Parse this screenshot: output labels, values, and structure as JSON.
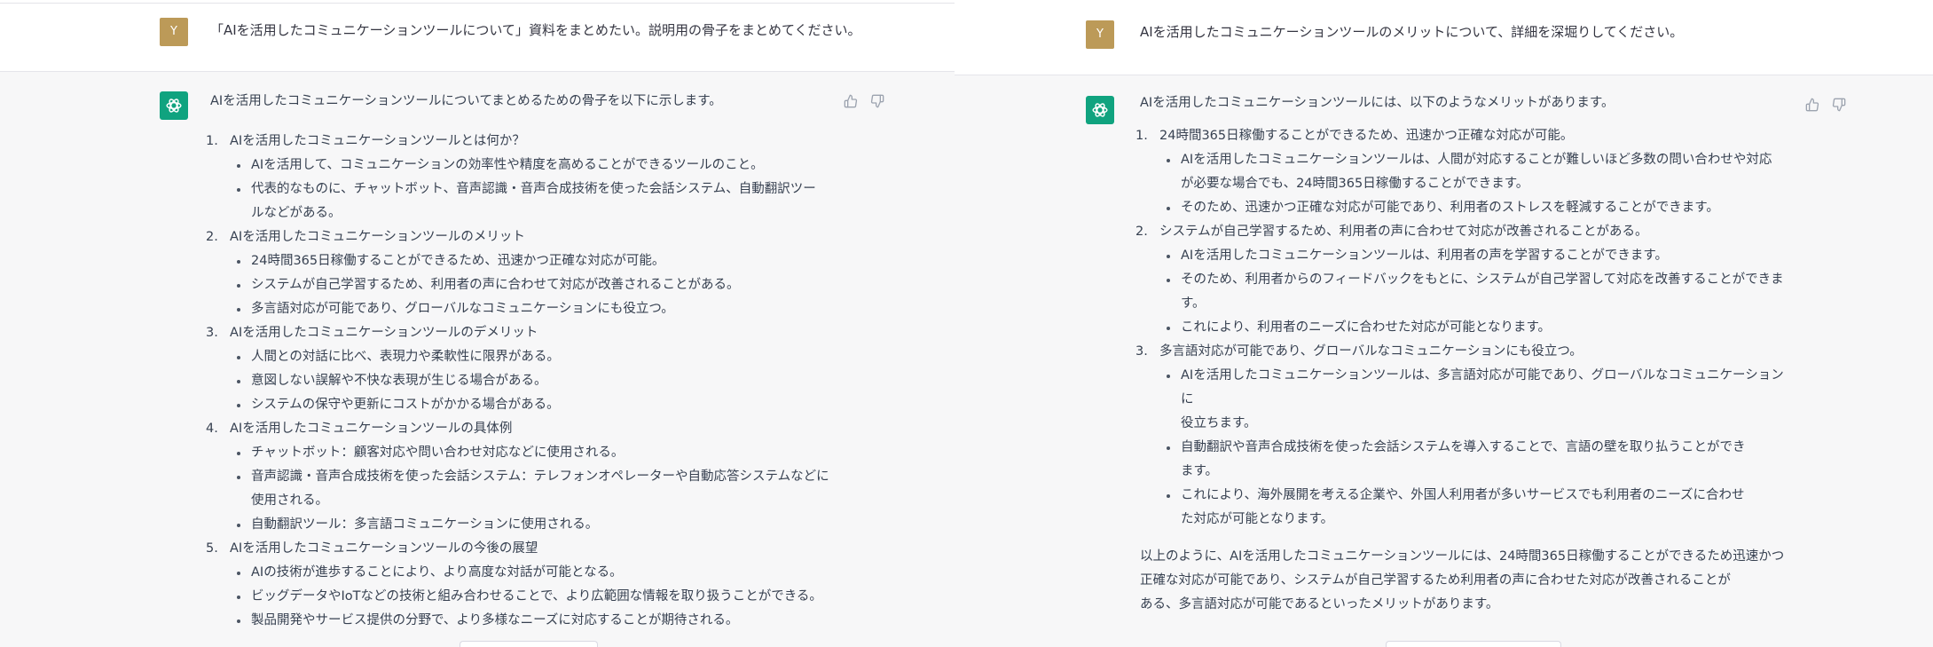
{
  "left": {
    "user": {
      "avatar_letter": "Y",
      "message": "「AIを活用したコミュニケーションツールについて」資料をまとめたい。説明用の骨子をまとめてください。"
    },
    "assistant": {
      "intro": "AIを活用したコミュニケーションツールについてまとめるための骨子を以下に示します。",
      "sections": [
        {
          "number": "1.",
          "title": "AIを活用したコミュニケーションツールとは何か？",
          "bullets": [
            "AIを活用して、コミュニケーションの効率性や精度を高めることができるツールのこと。",
            "代表的なものに、チャットボット、音声認識・音声合成技術を使った会話システム、自動翻訳ツー|ルなどがある。"
          ]
        },
        {
          "number": "2.",
          "title": "AIを活用したコミュニケーションツールのメリット",
          "bullets": [
            "24時間365日稼働することができるため、迅速かつ正確な対応が可能。",
            "システムが自己学習するため、利用者の声に合わせて対応が改善されることがある。",
            "多言語対応が可能であり、グローバルなコミュニケーションにも役立つ。"
          ]
        },
        {
          "number": "3.",
          "title": "AIを活用したコミュニケーションツールのデメリット",
          "bullets": [
            "人間との対話に比べ、表現力や柔軟性に限界がある。",
            "意図しない誤解や不快な表現が生じる場合がある。",
            "システムの保守や更新にコストがかかる場合がある。"
          ]
        },
        {
          "number": "4.",
          "title": "AIを活用したコミュニケーションツールの具体例",
          "bullets": [
            "チャットボット：顧客対応や問い合わせ対応などに使用される。",
            "音声認識・音声合成技術を使った会話システム：テレフォンオペレーターや自動応答システムなどに|使用される。",
            "自動翻訳ツール：多言語コミュニケーションに使用される。"
          ]
        },
        {
          "number": "5.",
          "title": "AIを活用したコミュニケーションツールの今後の展望",
          "bullets": [
            "AIの技術が進歩することにより、より高度な対話が可能となる。",
            "ビッグデータやIoTなどの技術と組み合わせることで、より広範囲な情報を取り扱うことができる。",
            "製品開発やサービス提供の分野で、より多様なニーズに対応することが期待される。"
          ]
        }
      ]
    }
  },
  "right": {
    "user": {
      "avatar_letter": "Y",
      "message": "AIを活用したコミュニケーションツールのメリットについて、詳細を深堀りしてください。"
    },
    "assistant": {
      "intro": "AIを活用したコミュニケーションツールには、以下のようなメリットがあります。",
      "sections": [
        {
          "number": "1.",
          "title": "24時間365日稼働することができるため、迅速かつ正確な対応が可能。",
          "bullets": [
            "AIを活用したコミュニケーションツールは、人間が対応することが難しいほど多数の問い合わせや対応|が必要な場合でも、24時間365日稼働することができます。",
            "そのため、迅速かつ正確な対応が可能であり、利用者のストレスを軽減することができます。"
          ]
        },
        {
          "number": "2.",
          "title": "システムが自己学習するため、利用者の声に合わせて対応が改善されることがある。",
          "bullets": [
            "AIを活用したコミュニケーションツールは、利用者の声を学習することができます。",
            "そのため、利用者からのフィードバックをもとに、システムが自己学習して対応を改善することができま|す。",
            "これにより、利用者のニーズに合わせた対応が可能となります。"
          ]
        },
        {
          "number": "3.",
          "title": "多言語対応が可能であり、グローバルなコミュニケーションにも役立つ。",
          "bullets": [
            "AIを活用したコミュニケーションツールは、多言語対応が可能であり、グローバルなコミュニケーションに|役立ちます。",
            "自動翻訳や音声合成技術を使った会話システムを導入することで、言語の壁を取り払うことができ|ます。",
            "これにより、海外展開を考える企業や、外国人利用者が多いサービスでも利用者のニーズに合わせ|た対応が可能となります。"
          ]
        }
      ],
      "conclusion": "以上のように、AIを活用したコミュニケーションツールには、24時間365日稼働することができるため迅速かつ|正確な対応が可能であり、システムが自己学習するため利用者の声に合わせた対応が改善されることが|ある、多言語対応が可能であるといったメリットがあります。"
    }
  },
  "icons": {
    "bot_avatar": "openai-logo-icon",
    "thumbs_up": "thumbs-up-icon",
    "thumbs_down": "thumbs-down-icon"
  },
  "colors": {
    "user_avatar": "#bc9a58",
    "bot_avatar": "#10a37f",
    "assistant_bg": "#f7f7f8",
    "text": "#374151"
  }
}
